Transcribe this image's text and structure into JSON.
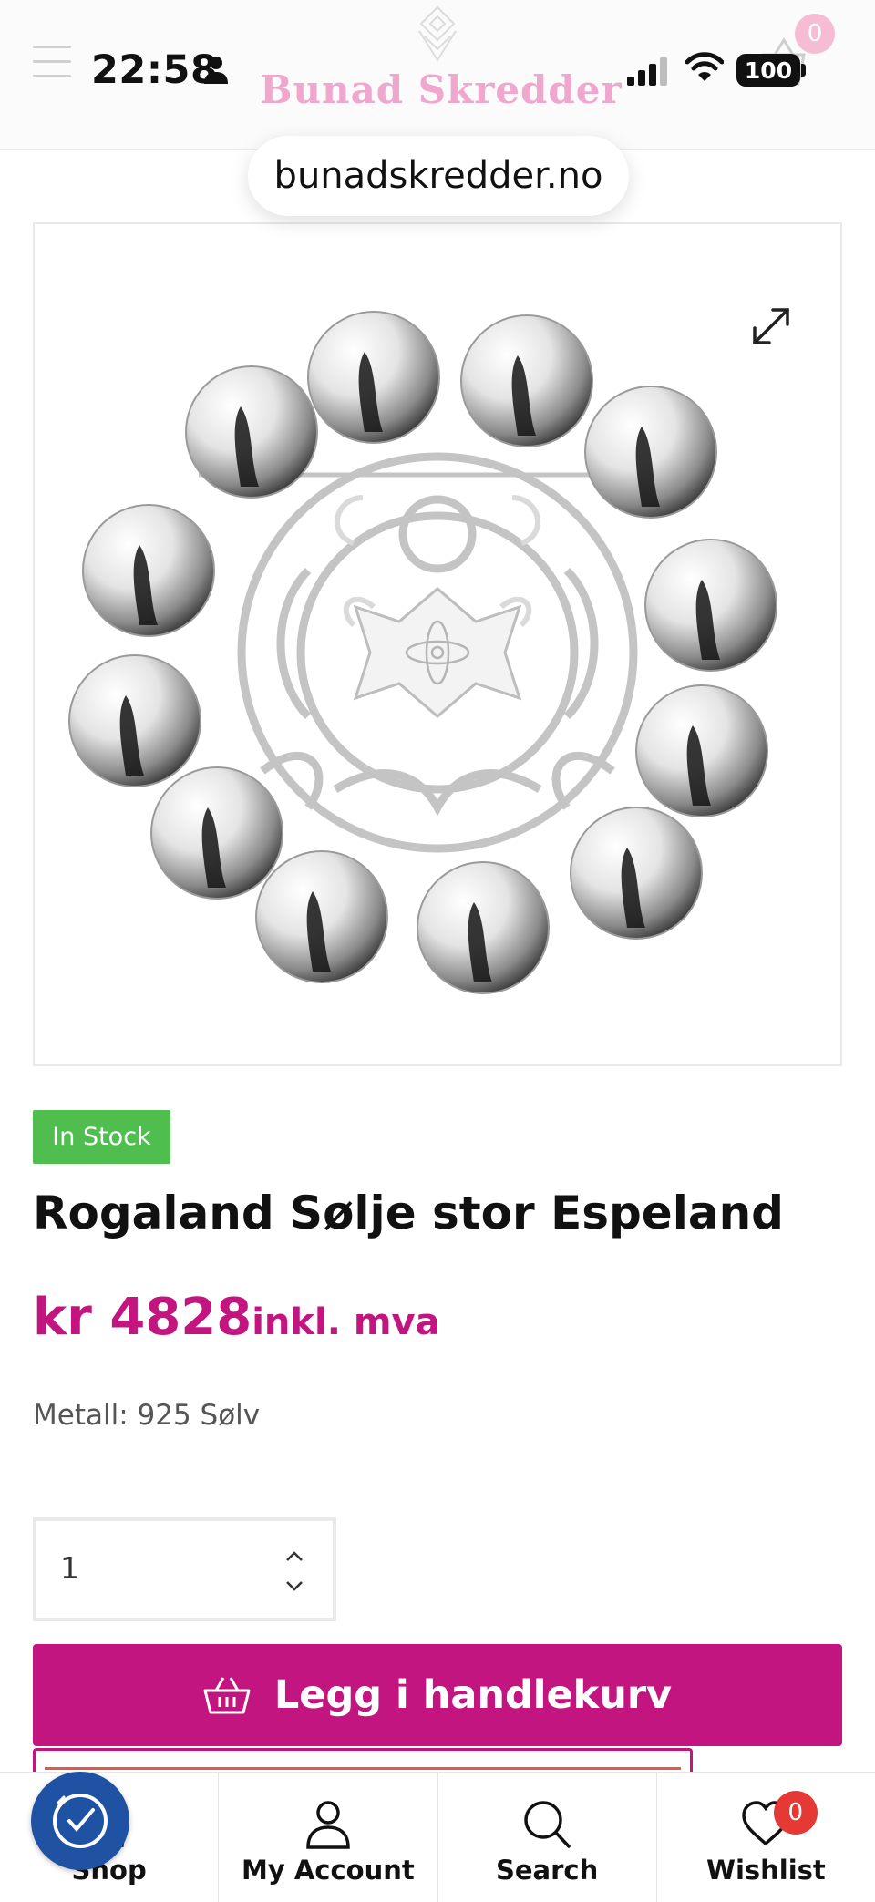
{
  "status_bar": {
    "time": "22:58",
    "battery": "100"
  },
  "header": {
    "brand_name": "Bunad Skredder",
    "cart_count": "0"
  },
  "browser": {
    "url": "bunadskredder.no"
  },
  "product": {
    "stock_status": "In Stock",
    "title": "Rogaland Sølje stor Espeland",
    "price": "kr 4828",
    "price_suffix": "inkl. mva",
    "meta": "Metall: 925 Sølv"
  },
  "purchase": {
    "quantity": "1",
    "add_to_cart_label": "Legg i handlekurv"
  },
  "bottom_nav": {
    "items": [
      {
        "label": "Shop",
        "icon": "bag-icon"
      },
      {
        "label": "My Account",
        "icon": "user-icon"
      },
      {
        "label": "Search",
        "icon": "search-icon"
      },
      {
        "label": "Wishlist",
        "icon": "heart-icon",
        "badge": "0"
      }
    ]
  },
  "colors": {
    "brand": "#c3157f",
    "brand_light": "#f0a7ce",
    "in_stock": "#4fbe4f",
    "badge_red": "#e53935",
    "a11y_blue": "#1f52a3"
  }
}
